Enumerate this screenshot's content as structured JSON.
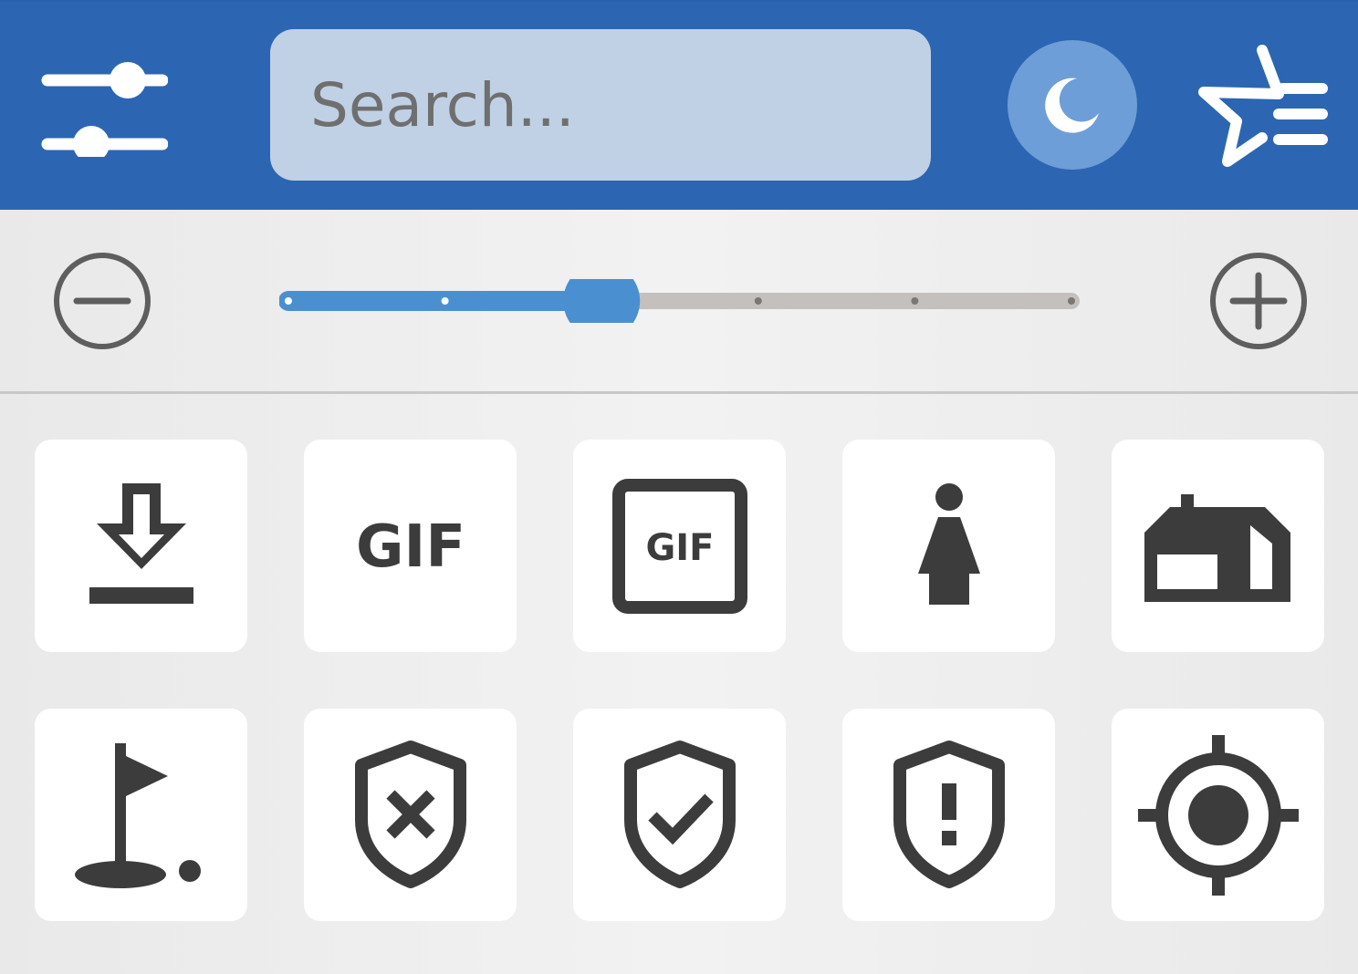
{
  "header": {
    "search": {
      "placeholder": "Search...",
      "value": ""
    },
    "icons": {
      "filter": "sliders-icon",
      "theme": "moon-icon",
      "favorites": "star-list-icon"
    },
    "colors": {
      "background": "#2c66b2",
      "search_bg": "#c0d1e5",
      "theme_button": "#6e9ed7"
    }
  },
  "zoom": {
    "decrease_icon": "minus-circle-icon",
    "increase_icon": "plus-circle-icon",
    "steps": 6,
    "current_step": 2,
    "colors": {
      "active": "#4a90d0",
      "track": "#c4c0be"
    }
  },
  "icons": {
    "items": [
      {
        "name": "download-icon"
      },
      {
        "name": "gif-icon",
        "text": "GIF"
      },
      {
        "name": "gif-box-icon",
        "text": "GIF"
      },
      {
        "name": "woman-icon"
      },
      {
        "name": "cottage-icon"
      },
      {
        "name": "golf-course-icon"
      },
      {
        "name": "shield-x-icon"
      },
      {
        "name": "shield-check-icon"
      },
      {
        "name": "shield-alert-icon"
      },
      {
        "name": "my-location-icon"
      }
    ],
    "color": "#3d3c3d"
  }
}
